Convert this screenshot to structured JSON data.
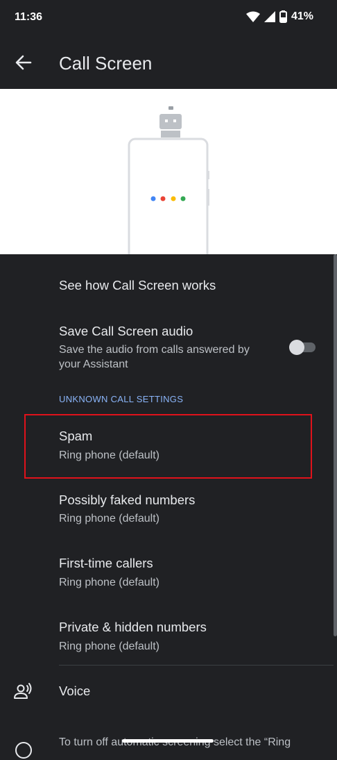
{
  "status_bar": {
    "time": "11:36",
    "battery": "41%"
  },
  "app_bar": {
    "title": "Call Screen"
  },
  "settings": {
    "see_how": "See how Call Screen works",
    "save_audio_title": "Save Call Screen audio",
    "save_audio_sub_line1": "Save the audio from calls answered by",
    "save_audio_sub_line2": "your Assistant",
    "save_audio_enabled": false
  },
  "unknown_calls": {
    "header": "UNKNOWN CALL SETTINGS",
    "items": [
      {
        "title": "Spam",
        "value": "Ring phone (default)"
      },
      {
        "title": "Possibly faked numbers",
        "value": "Ring phone (default)"
      },
      {
        "title": "First-time callers",
        "value": "Ring phone (default)"
      },
      {
        "title": "Private & hidden numbers",
        "value": "Ring phone (default)"
      }
    ]
  },
  "voice": {
    "label": "Voice"
  },
  "footer": {
    "text": "To turn off automatic screening select the “Ring"
  },
  "colors": {
    "background": "#202124",
    "accent": "#8ab4f8",
    "highlight": "#e0121b",
    "dots": [
      "#4285f4",
      "#ea4335",
      "#fbbc04",
      "#34a853"
    ]
  },
  "icons": {
    "back": "arrow-left-icon",
    "wifi": "wifi-icon",
    "cell": "cell-signal-icon",
    "battery": "battery-icon",
    "voice": "voice-person-icon",
    "info": "info-icon"
  }
}
